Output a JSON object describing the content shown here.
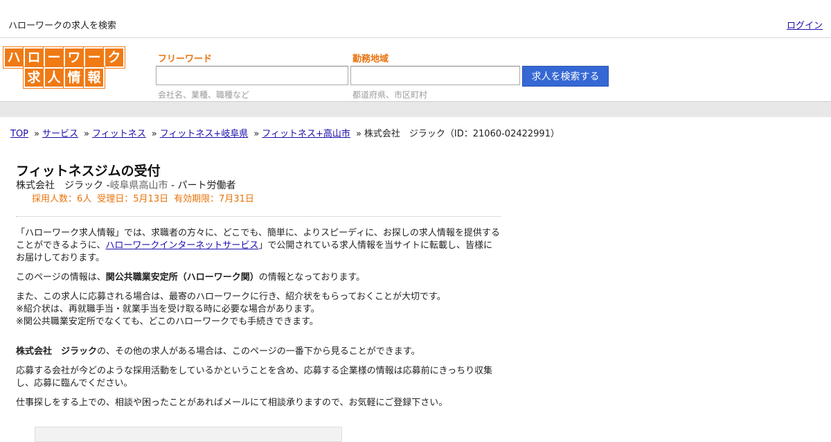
{
  "header": {
    "tagline": "ハローワークの求人を検索",
    "login": "ログイン"
  },
  "logo": {
    "row1": [
      "ハ",
      "ロ",
      "ー",
      "ワ",
      "ー",
      "ク"
    ],
    "row2": [
      "求",
      "人",
      "情",
      "報"
    ],
    "color": "#f07a14"
  },
  "search": {
    "keyword_label": "フリーワード",
    "keyword_value": "",
    "keyword_hint": "会社名、業種、職種など",
    "area_label": "勤務地域",
    "area_value": "",
    "area_hint": "都道府県、市区町村",
    "button": "求人を検索する",
    "button_color": "#3568d4"
  },
  "breadcrumb": {
    "items": [
      "TOP",
      "サービス",
      "フィットネス",
      "フィットネス+岐阜県",
      "フィットネス+高山市"
    ],
    "current": "株式会社　ジラック（ID：21060-02422991）"
  },
  "job": {
    "title": "フィットネスジムの受付",
    "company": "株式会社　ジラック -",
    "location": "岐阜県高山市",
    "employment": " - パート労働者",
    "hires": "採用人数：6人",
    "received": "受理日：5月13日",
    "expires": "有効期限：7月31日"
  },
  "content": {
    "p1_a": "「ハローワーク求人情報」では、求職者の方々に、どこでも、簡単に、よりスピーディに、お探しの求人情報を提供することができるように、",
    "p1_link": "ハローワークインターネットサービス",
    "p1_b": "」で公開されている求人情報を当サイトに転載し、皆様にお届けしております。",
    "p2_a": "このページの情報は、",
    "p2_bold": "関公共職業安定所（ハローワーク関）",
    "p2_b": "の情報となっております。",
    "p3_1": "また、この求人に応募される場合は、最寄のハローワークに行き、紹介状をもらっておくことが大切です。",
    "p3_2": "※紹介状は、再就職手当・就業手当を受け取る時に必要な場合があります。",
    "p3_3": "※関公共職業安定所でなくても、どこのハローワークでも手続きできます。",
    "p4_bold": "株式会社　ジラック",
    "p4_b": "の、その他の求人がある場合は、このページの一番下から見ることができます。",
    "p5": "応募する会社が今どのような採用活動をしているかということを含め、応募する企業様の情報は応募前にきっちり収集し、応募に臨んでください。",
    "p6": "仕事探しをする上での、相談や困ったことがあればメールにて相談承りますので、お気軽にご登録下さい。"
  },
  "colors": {
    "accent_orange": "#e8730c",
    "link": "#1a0dab"
  }
}
